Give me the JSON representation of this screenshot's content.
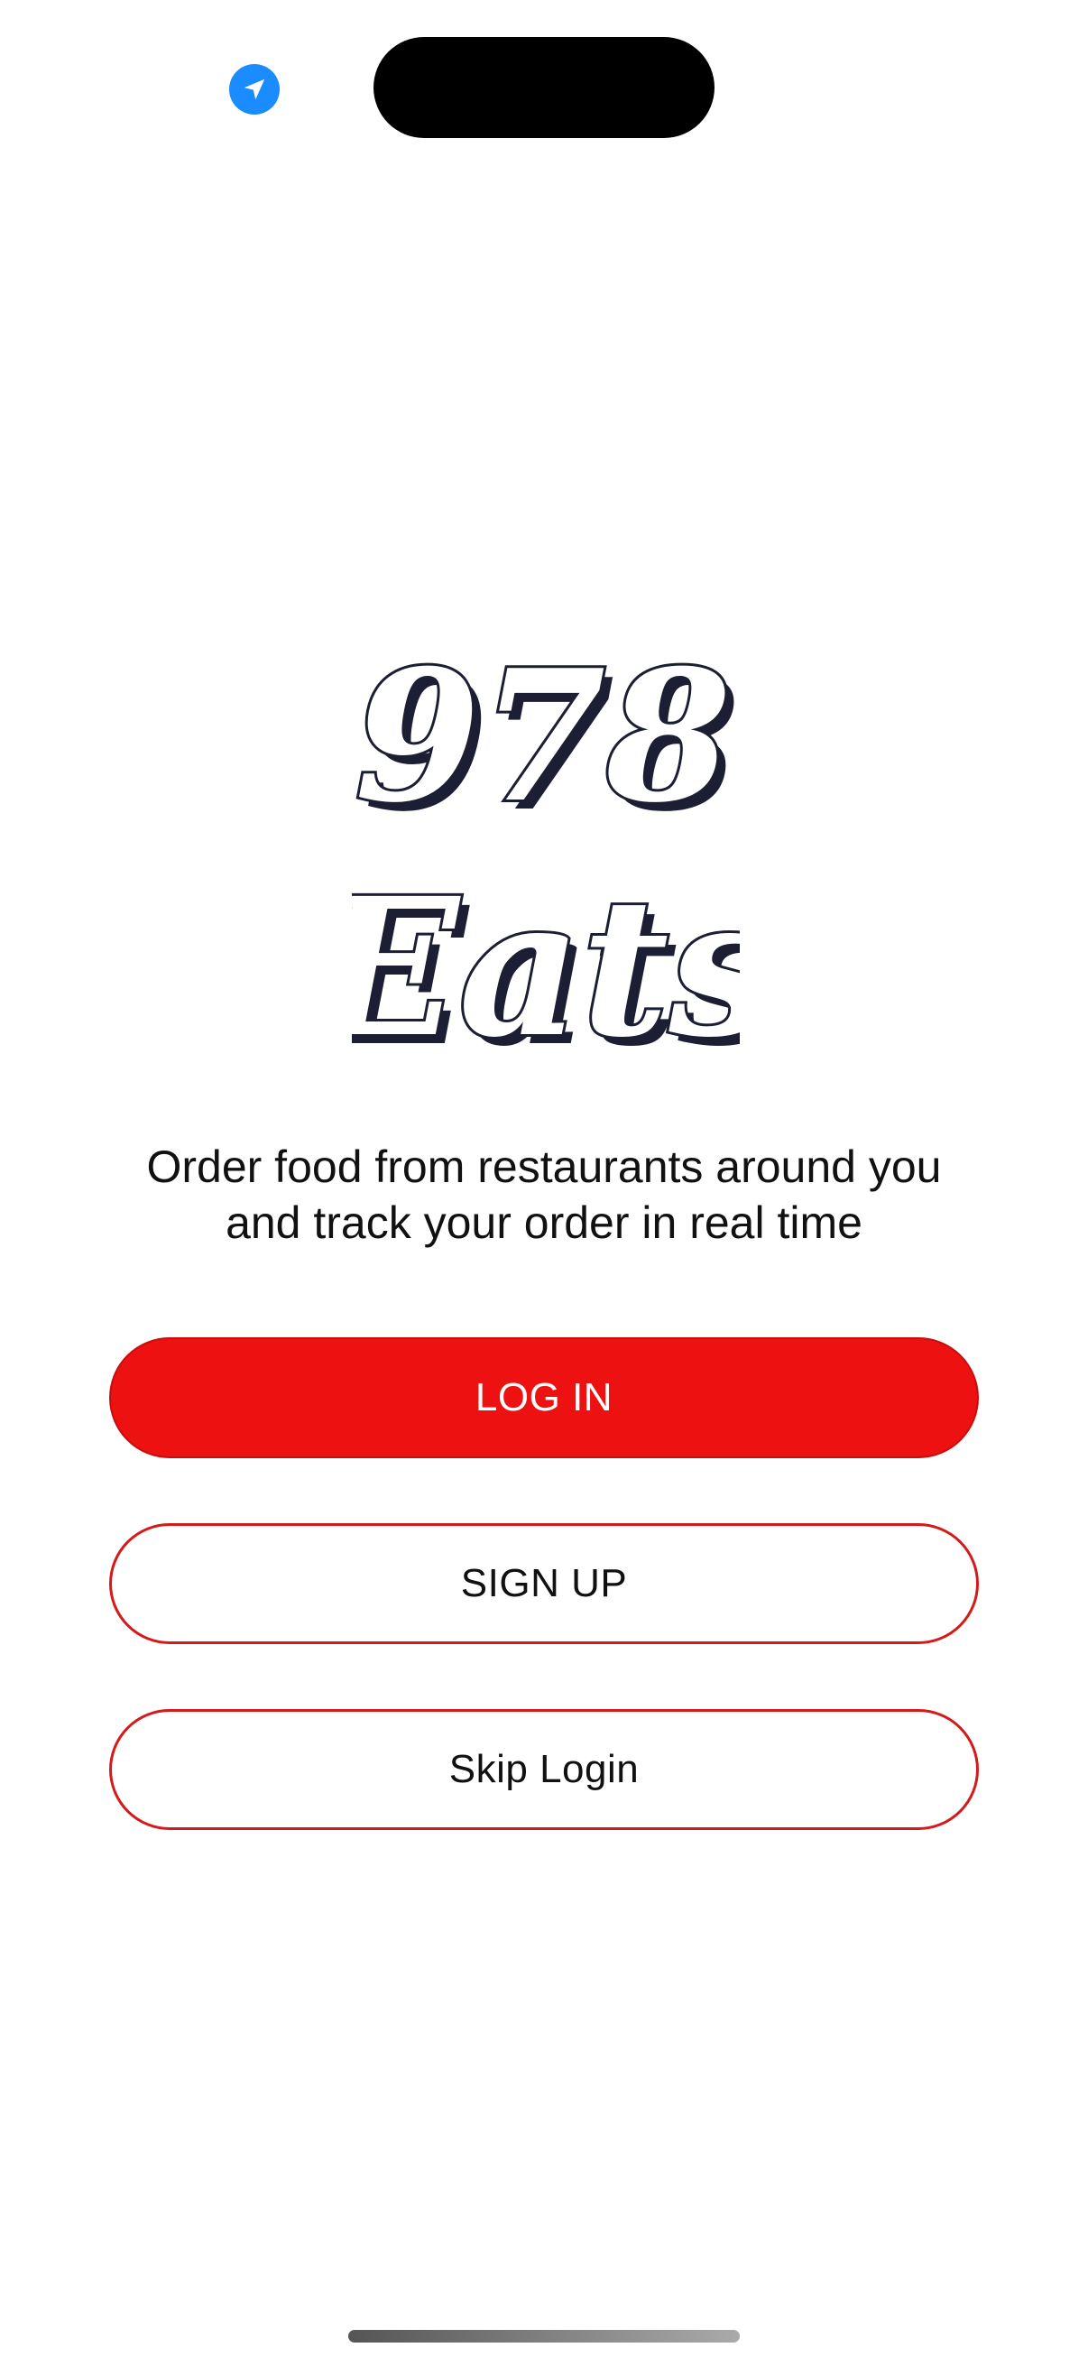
{
  "status_bar": {
    "location_icon": "location-arrow-icon",
    "location_icon_color": "#1a8cff"
  },
  "logo": {
    "line1": "978",
    "line2": "Eats"
  },
  "tagline": {
    "line1": "Order food from restaurants around you",
    "line2": "and track your order in real time"
  },
  "buttons": {
    "login_label": "LOG IN",
    "signup_label": "SIGN UP",
    "skip_label": "Skip Login"
  },
  "colors": {
    "accent": "#ee1111",
    "outline": "#d41a1a",
    "logo_shadow": "#1c1f33"
  }
}
